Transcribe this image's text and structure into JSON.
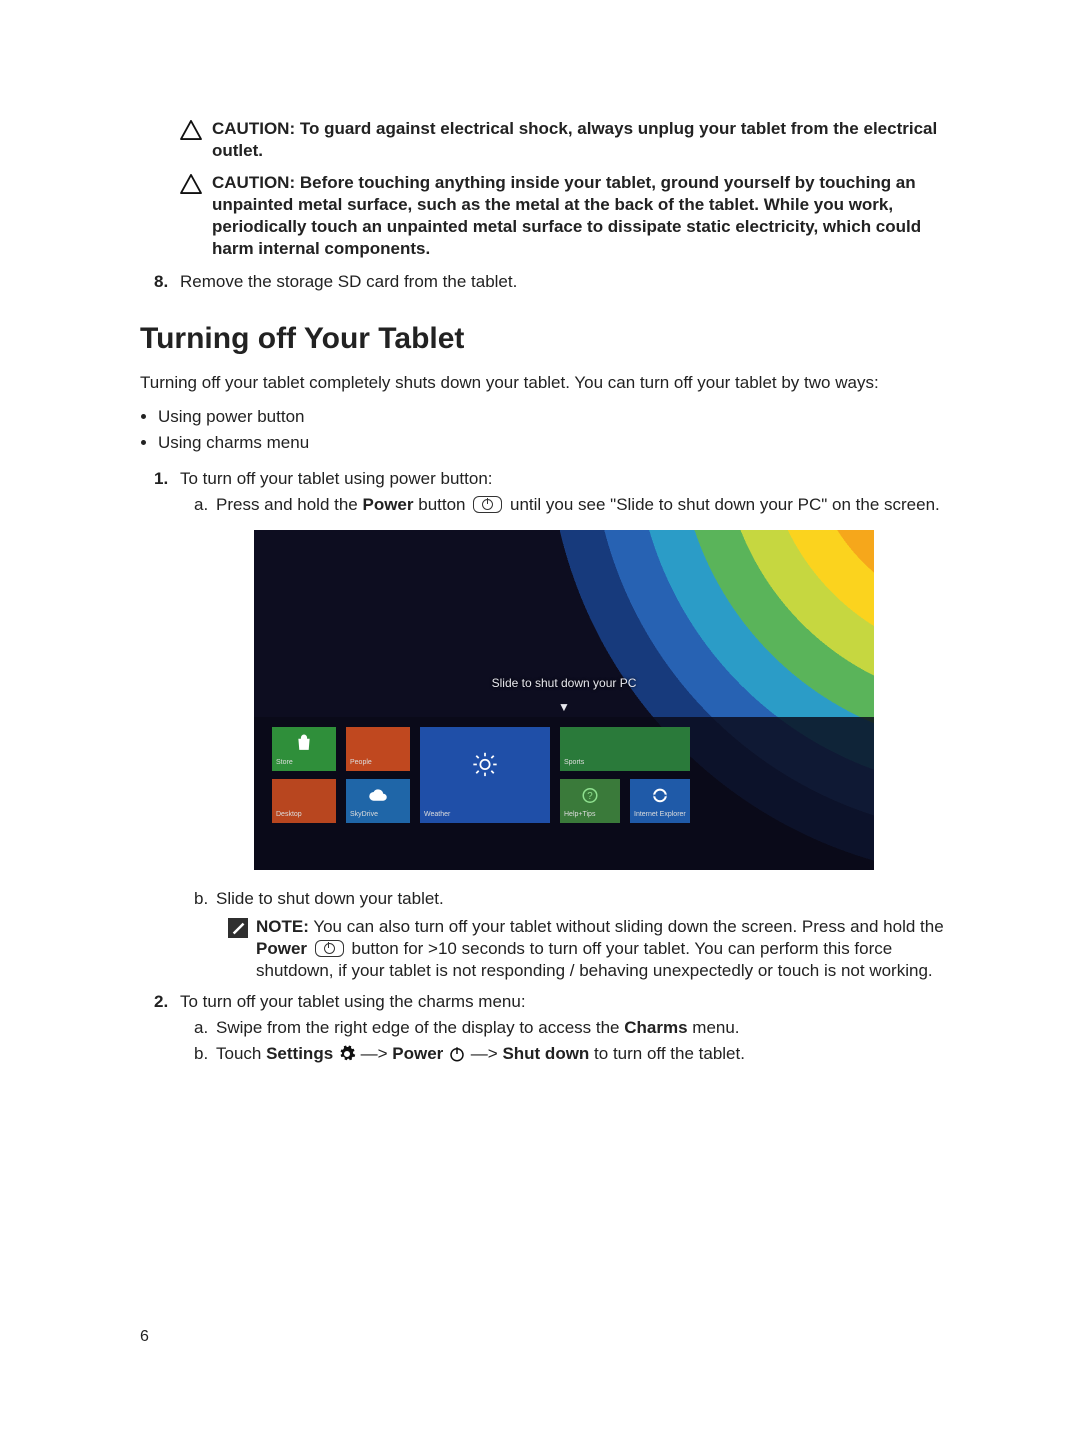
{
  "cautions": [
    {
      "label": "CAUTION:",
      "text": "To guard against electrical shock, always unplug your tablet from the electrical outlet."
    },
    {
      "label": "CAUTION:",
      "text": "Before touching anything inside your tablet, ground yourself by touching an unpainted metal surface, such as the metal at the back of the tablet. While you work, periodically touch an unpainted metal surface to dissipate static electricity, which could harm internal components."
    }
  ],
  "step8": {
    "num": "8.",
    "text": "Remove the storage SD card from the tablet."
  },
  "heading": "Turning off Your Tablet",
  "intro": "Turning off your tablet completely shuts down your tablet. You can turn off your tablet by two ways:",
  "bullets": [
    "Using power button",
    "Using charms menu"
  ],
  "method1": {
    "num": "1.",
    "text": "To turn off your tablet using power button:",
    "sub_a": {
      "letter": "a.",
      "before": "Press and hold the ",
      "power_word": "Power",
      "mid": " button ",
      "after": " until you see \"Slide to shut down your PC\" on the screen."
    },
    "screenshot": {
      "slide_text": "Slide to shut down your PC",
      "tiles": {
        "store": "Store",
        "desktop": "Desktop",
        "people": "People",
        "skydrive": "SkyDrive",
        "weather": "Weather",
        "sports": "Sports",
        "help": "Help+Tips",
        "ie": "Internet Explorer"
      }
    },
    "sub_b": {
      "letter": "b.",
      "text": "Slide to shut down your tablet."
    },
    "note": {
      "label": "NOTE:",
      "before": " You can also turn off your tablet without sliding down the screen. Press and hold the ",
      "power_word": "Power",
      "mid": " ",
      "after": " button for >10 seconds to turn off your tablet. You can perform this force shutdown, if your tablet is not responding / behaving unexpectedly or touch is not working."
    }
  },
  "method2": {
    "num": "2.",
    "text": "To turn off your tablet using the charms menu:",
    "sub_a": {
      "letter": "a.",
      "before": "Swipe from the right edge of the display to access the ",
      "bold": "Charms",
      "after": " menu."
    },
    "sub_b": {
      "letter": "b.",
      "t1": "Touch ",
      "settings": "Settings",
      "arrow1": " —> ",
      "power": "Power",
      "arrow2": " —> ",
      "shutdown": "Shut down",
      "tail": " to turn off the tablet."
    }
  },
  "page_number": "6"
}
